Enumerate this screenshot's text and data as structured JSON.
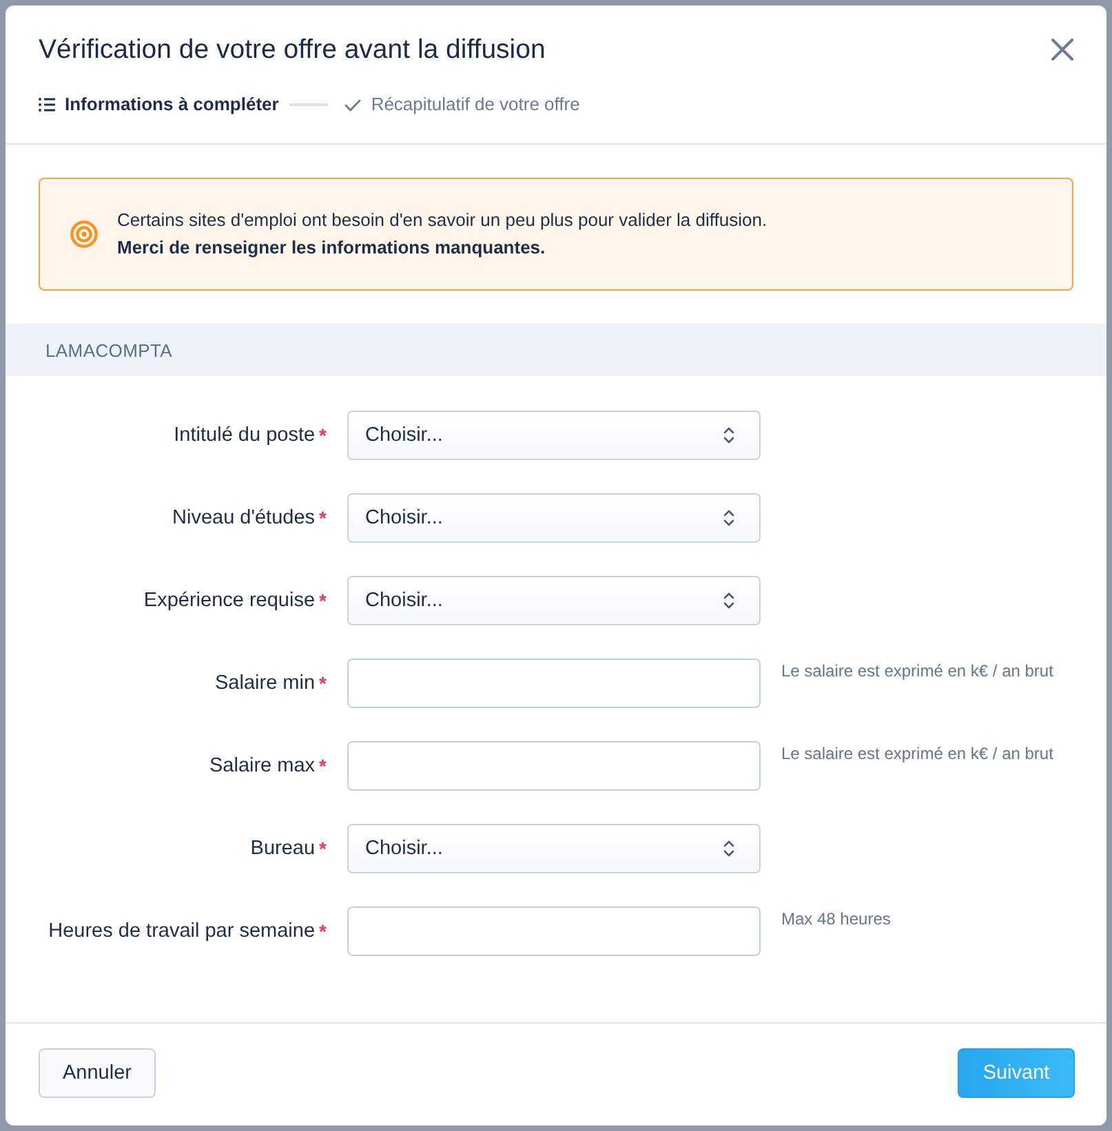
{
  "dialog": {
    "title": "Vérification de votre offre avant la diffusion"
  },
  "steps": [
    {
      "label": "Informations à compléter",
      "kind": "list",
      "selected": true
    },
    {
      "label": "Récapitulatif de votre offre",
      "kind": "check",
      "selected": false
    }
  ],
  "alert": {
    "message": "Certains sites d'emploi ont besoin d'en savoir un peu plus pour valider la diffusion.",
    "emphasis": "Merci de renseigner les informations manquantes."
  },
  "section": {
    "title": "LAMACOMPTA"
  },
  "fields": [
    {
      "label": "Intitulé du poste",
      "required_mark": "*",
      "kind": "select",
      "value": "Choisir..."
    },
    {
      "label": "Niveau d'études",
      "required_mark": "*",
      "kind": "select",
      "value": "Choisir..."
    },
    {
      "label": "Expérience requise",
      "required_mark": "*",
      "kind": "select",
      "value": "Choisir..."
    },
    {
      "label": "Salaire min",
      "required_mark": "*",
      "kind": "input",
      "hint": "Le salaire est exprimé en k€ / an brut"
    },
    {
      "label": "Salaire max",
      "required_mark": "*",
      "kind": "input",
      "hint": "Le salaire est exprimé en k€ / an brut"
    },
    {
      "label": "Bureau",
      "required_mark": "*",
      "kind": "select",
      "value": "Choisir..."
    },
    {
      "label": "Heures de travail par semaine",
      "required_mark": "*",
      "kind": "input",
      "hint": "Max 48 heures"
    }
  ],
  "buttons": [
    {
      "label": "Annuler",
      "kind": "secondary"
    },
    {
      "label": "Suivant",
      "kind": "primary"
    }
  ]
}
